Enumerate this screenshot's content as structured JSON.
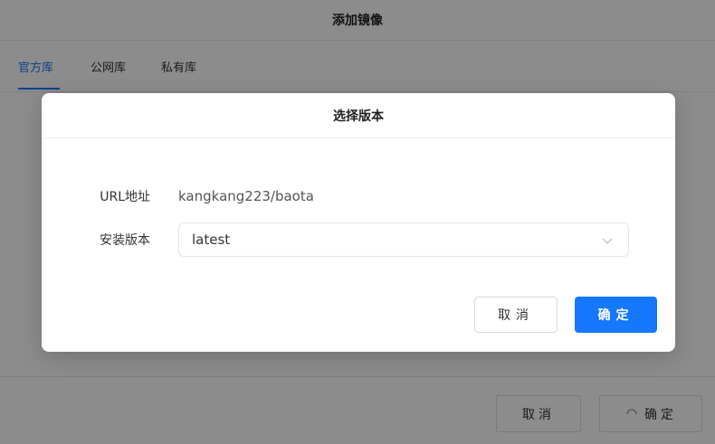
{
  "outer_dialog": {
    "title": "添加镜像",
    "tabs": [
      {
        "label": "官方库",
        "active": true
      },
      {
        "label": "公网库",
        "active": false
      },
      {
        "label": "私有库",
        "active": false
      }
    ],
    "footer": {
      "cancel_label": "取消",
      "confirm_label": "确定"
    }
  },
  "modal": {
    "title": "选择版本",
    "url_label": "URL地址",
    "url_value": "kangkang223/baota",
    "version_label": "安装版本",
    "version_value": "latest",
    "cancel_label": "取消",
    "confirm_label": "确定"
  },
  "colors": {
    "accent": "#1677ff",
    "border": "#e6e6e6"
  }
}
